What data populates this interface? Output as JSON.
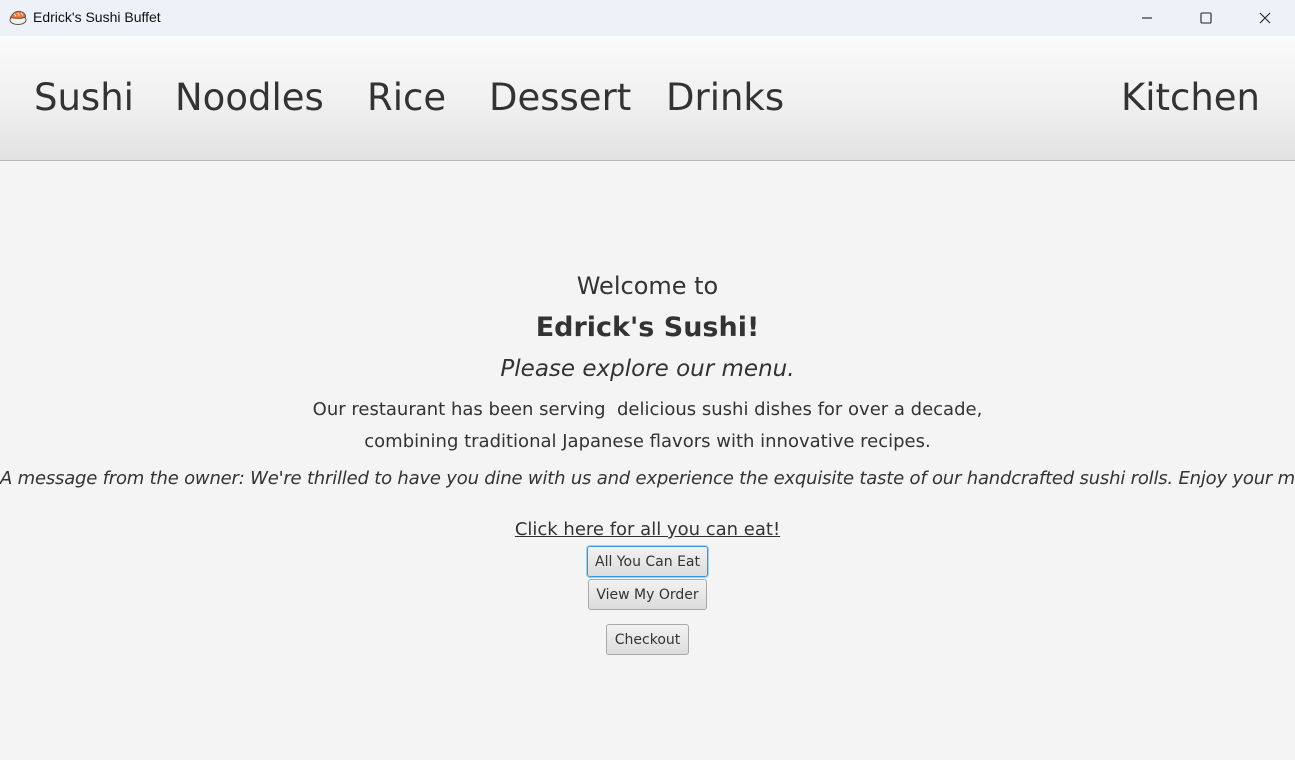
{
  "window": {
    "title": "Edrick's Sushi Buffet",
    "icon": "sushi-icon",
    "controls": [
      "minimize-icon",
      "maximize-icon",
      "close-icon"
    ]
  },
  "nav": {
    "items": [
      "Sushi",
      "Noodles",
      "Rice",
      "Dessert",
      "Drinks"
    ],
    "kitchen": "Kitchen"
  },
  "main": {
    "welcome": "Welcome to",
    "restaurant_name": "Edrick's Sushi!",
    "tagline": "Please explore our menu.",
    "description_line1": "Our restaurant has been serving  delicious sushi dishes for over a decade,",
    "description_line2": "combining traditional Japanese flavors with innovative recipes.",
    "owner_message": "A message from the owner: We're thrilled to have you dine with us and experience the exquisite taste of our handcrafted sushi rolls. Enjoy your meal!",
    "all_you_can_eat_link": "Click here for all you can eat!",
    "buttons": {
      "all_you_can_eat": "All You Can Eat",
      "view_order": "View My Order",
      "checkout": "Checkout"
    }
  },
  "colors": {
    "background": "#f4f4f4",
    "text": "#333333",
    "focus_border": "#3a9ad9",
    "titlebar": "#eef1f8"
  }
}
